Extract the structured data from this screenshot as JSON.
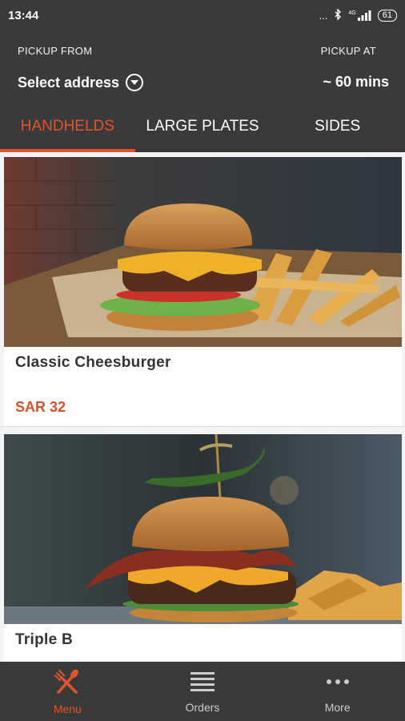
{
  "status": {
    "time": "13:44",
    "battery": "61",
    "signal": "...",
    "network_badge": "4G"
  },
  "header": {
    "pickup_from_label": "PICKUP FROM",
    "address_value": "Select address",
    "pickup_at_label": "PICKUP AT",
    "pickup_time": "~ 60 mins"
  },
  "tabs": [
    {
      "label": "HANDHELDS",
      "active": true
    },
    {
      "label": "LARGE PLATES",
      "active": false
    },
    {
      "label": "SIDES",
      "active": false
    }
  ],
  "items": [
    {
      "name": "Classic Cheesburger",
      "price": "SAR 32"
    },
    {
      "name": "Triple B",
      "price": ""
    }
  ],
  "nav": [
    {
      "label": "Menu",
      "icon": "fork-spoon-icon",
      "active": true
    },
    {
      "label": "Orders",
      "icon": "list-icon",
      "active": false
    },
    {
      "label": "More",
      "icon": "dots-icon",
      "active": false
    }
  ],
  "colors": {
    "accent": "#e2542c",
    "header_bg": "#3a3a3a",
    "price": "#d8512b"
  }
}
